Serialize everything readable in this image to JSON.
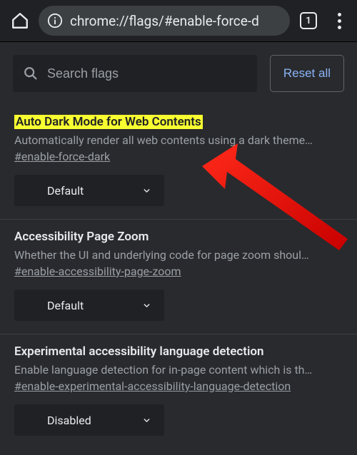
{
  "toolbar": {
    "url": "chrome://flags/#enable-force-d",
    "tab_count": "1"
  },
  "search": {
    "placeholder": "Search flags",
    "value": ""
  },
  "reset_label": "Reset all",
  "flags": [
    {
      "title": "Auto Dark Mode for Web Contents",
      "highlighted": true,
      "description": "Automatically render all web contents using a dark theme…",
      "anchor": "#enable-force-dark",
      "selected": "Default"
    },
    {
      "title": "Accessibility Page Zoom",
      "highlighted": false,
      "description": "Whether the UI and underlying code for page zoom shoul…",
      "anchor": "#enable-accessibility-page-zoom",
      "selected": "Default"
    },
    {
      "title": "Experimental accessibility language detection",
      "highlighted": false,
      "description": "Enable language detection for in-page content which is th…",
      "anchor": "#enable-experimental-accessibility-language-detection",
      "selected": "Disabled"
    }
  ]
}
